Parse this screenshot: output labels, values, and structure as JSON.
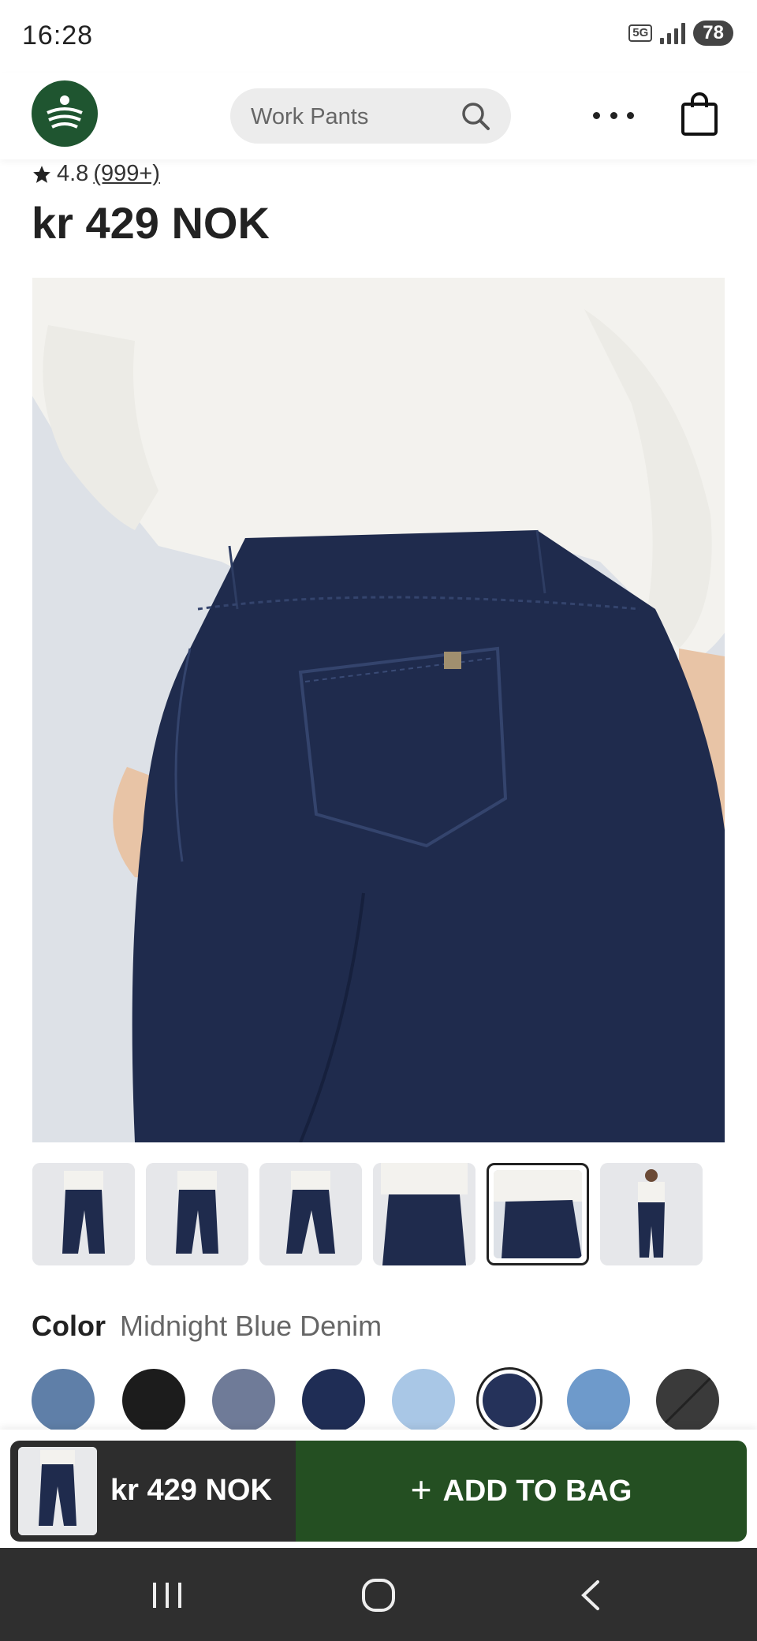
{
  "status_bar": {
    "time": "16:28",
    "network": "5G",
    "battery": "78"
  },
  "header": {
    "logo_icon": "brand-logo-icon",
    "search_placeholder": "Work Pants",
    "search_icon": "search-icon",
    "more_icon": "more-horizontal-icon",
    "bag_icon": "shopping-bag-icon"
  },
  "product": {
    "rating": "4.8",
    "review_count": "(999+)",
    "price": "kr 429 NOK",
    "image_alt": "Midnight blue denim pull-on pants, back view"
  },
  "gallery": {
    "thumbnail_count": 6,
    "selected_index": 4
  },
  "color": {
    "label": "Color",
    "selected_name": "Midnight Blue Denim",
    "swatches": [
      {
        "name": "light-denim",
        "color": "#5f7fa8"
      },
      {
        "name": "black",
        "color": "#1c1c1c"
      },
      {
        "name": "grey-blue",
        "color": "#6f7b98"
      },
      {
        "name": "navy",
        "color": "#1f2d55"
      },
      {
        "name": "light-blue",
        "color": "#a9c7e6"
      },
      {
        "name": "midnight-blue-denim",
        "color": "#25325a"
      },
      {
        "name": "stonewash",
        "color": "#6e9acb"
      },
      {
        "name": "charcoal",
        "color": "#3a3a3a"
      }
    ]
  },
  "sticky_bar": {
    "price": "kr 429 NOK",
    "add_to_bag": "ADD TO BAG"
  }
}
